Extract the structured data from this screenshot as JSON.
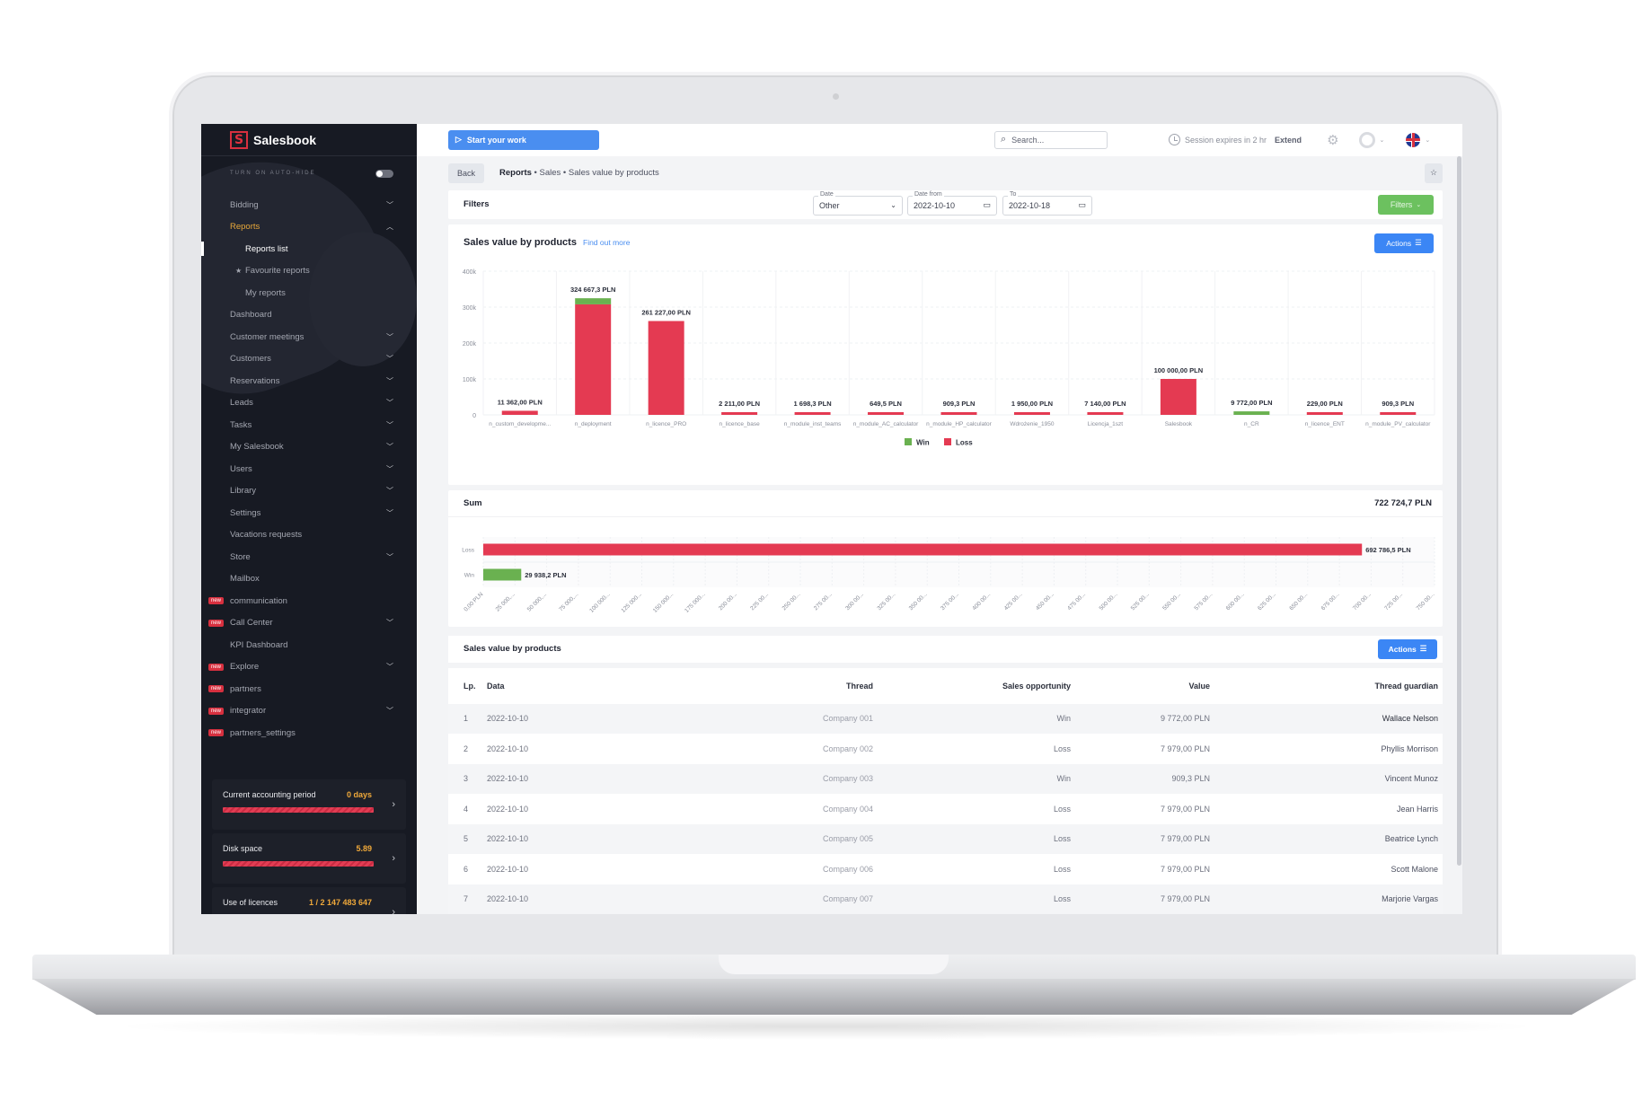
{
  "app": {
    "brand": "Salesbook",
    "logo_letter": "S"
  },
  "sidebar": {
    "autohide_label": "TURN ON AUTO-HIDE",
    "items": [
      {
        "label": "Bidding",
        "chevron": "down",
        "state": "",
        "badge": ""
      },
      {
        "label": "Reports",
        "chevron": "up",
        "state": "active",
        "badge": ""
      },
      {
        "label": "Reports list",
        "chevron": "",
        "state": "sub current",
        "badge": ""
      },
      {
        "label": "Favourite reports",
        "chevron": "",
        "state": "sub star",
        "badge": ""
      },
      {
        "label": "My reports",
        "chevron": "",
        "state": "sub",
        "badge": ""
      },
      {
        "label": "Dashboard",
        "chevron": "",
        "state": "",
        "badge": ""
      },
      {
        "label": "Customer meetings",
        "chevron": "down",
        "state": "",
        "badge": ""
      },
      {
        "label": "Customers",
        "chevron": "down",
        "state": "",
        "badge": ""
      },
      {
        "label": "Reservations",
        "chevron": "down",
        "state": "",
        "badge": ""
      },
      {
        "label": "Leads",
        "chevron": "down",
        "state": "",
        "badge": ""
      },
      {
        "label": "Tasks",
        "chevron": "down",
        "state": "",
        "badge": ""
      },
      {
        "label": "My Salesbook",
        "chevron": "down",
        "state": "",
        "badge": ""
      },
      {
        "label": "Users",
        "chevron": "down",
        "state": "",
        "badge": ""
      },
      {
        "label": "Library",
        "chevron": "down",
        "state": "",
        "badge": ""
      },
      {
        "label": "Settings",
        "chevron": "down",
        "state": "",
        "badge": ""
      },
      {
        "label": "Vacations requests",
        "chevron": "",
        "state": "",
        "badge": ""
      },
      {
        "label": "Store",
        "chevron": "down",
        "state": "",
        "badge": ""
      },
      {
        "label": "Mailbox",
        "chevron": "",
        "state": "",
        "badge": ""
      },
      {
        "label": "communication",
        "chevron": "",
        "state": "",
        "badge": "new"
      },
      {
        "label": "Call Center",
        "chevron": "down",
        "state": "",
        "badge": "new"
      },
      {
        "label": "KPI Dashboard",
        "chevron": "",
        "state": "",
        "badge": ""
      },
      {
        "label": "Explore",
        "chevron": "down",
        "state": "",
        "badge": "new"
      },
      {
        "label": "partners",
        "chevron": "",
        "state": "",
        "badge": "new"
      },
      {
        "label": "integrator",
        "chevron": "down",
        "state": "",
        "badge": "new"
      },
      {
        "label": "partners_settings",
        "chevron": "",
        "state": "",
        "badge": "new"
      }
    ],
    "stats": [
      {
        "label": "Current accounting period",
        "value": "0 days",
        "fill": 1.0
      },
      {
        "label": "Disk space",
        "value": "5.89",
        "fill": 1.0
      },
      {
        "label": "Use of licences",
        "value": "1 / 2 147 483 647",
        "fill": 0.0
      }
    ]
  },
  "topbar": {
    "start_label": "Start your work",
    "search_placeholder": "Search...",
    "session_text": "Session expires in 2 hr",
    "extend_label": "Extend"
  },
  "breadcrumb": {
    "back_label": "Back",
    "root": "Reports",
    "separator": "•",
    "level2": "Sales",
    "current": "Sales value by products"
  },
  "filters": {
    "title": "Filters",
    "date_label": "Date",
    "date_value": "Other",
    "from_label": "Date from",
    "from_value": "2022-10-10",
    "to_label": "To",
    "to_value": "2022-10-18",
    "button_label": "Filters"
  },
  "chart_section": {
    "title": "Sales value by products",
    "link": "Find out more",
    "actions_label": "Actions"
  },
  "sum_section": {
    "title": "Sum",
    "total": "722 724,7 PLN"
  },
  "colors": {
    "win": "#6ab150",
    "loss": "#e43a52",
    "accent": "#3b86f5",
    "active_nav": "#e8a83a"
  },
  "chart_data": [
    {
      "type": "bar",
      "stacked": true,
      "title": "Sales value by products",
      "xlabel": "",
      "ylabel": "",
      "ylim": [
        0,
        400000
      ],
      "yticks": [
        "0",
        "100k",
        "200k",
        "300k",
        "400k"
      ],
      "yticks_values": [
        0,
        100000,
        200000,
        300000,
        400000
      ],
      "grid": true,
      "legend": "bottom-center",
      "categories": [
        "n_custom_developme...",
        "n_deployment",
        "n_licence_PRO",
        "n_licence_base",
        "n_module_inst_teams",
        "n_module_AC_calculator",
        "n_module_HP_calculator",
        "Wdrożenie_1950",
        "Licencja_1szt",
        "Salesbook",
        "n_CR",
        "n_licence_ENT",
        "n_module_PV_calculator"
      ],
      "data_labels": [
        "11 362,00 PLN",
        "324 667,3 PLN",
        "261 227,00 PLN",
        "2 211,00 PLN",
        "1 698,3 PLN",
        "649,5 PLN",
        "909,3 PLN",
        "1 950,00 PLN",
        "7 140,00 PLN",
        "100 000,00 PLN",
        "9 772,00 PLN",
        "229,00 PLN",
        "909,3 PLN"
      ],
      "series": [
        {
          "name": "Win",
          "color": "#6ab150",
          "values": [
            0,
            17000,
            0,
            0,
            0,
            0,
            0,
            0,
            0,
            0,
            9772,
            0,
            0
          ]
        },
        {
          "name": "Loss",
          "color": "#e43a52",
          "values": [
            11362,
            307667.3,
            261227,
            2211,
            1698.3,
            649.5,
            909.3,
            1950,
            7140,
            100000,
            0,
            229,
            909.3
          ]
        }
      ]
    },
    {
      "type": "bar",
      "orientation": "horizontal",
      "title": "Sum",
      "categories": [
        "Loss",
        "Win"
      ],
      "values": [
        692786.5,
        29938.2
      ],
      "data_labels": [
        "692 786,5 PLN",
        "29 938,2 PLN"
      ],
      "colors": [
        "#e43a52",
        "#6ab150"
      ],
      "xlim": [
        0,
        750000
      ],
      "xticks": [
        "0,00 PLN",
        "25 000,...",
        "50 000,...",
        "75 000,...",
        "100 000...",
        "125 000...",
        "150 000...",
        "175 000...",
        "200 00...",
        "225 00...",
        "250 00...",
        "275 00...",
        "300 00...",
        "325 00...",
        "350 00...",
        "375 00...",
        "400 00...",
        "425 00...",
        "450 00...",
        "475 00...",
        "500 00...",
        "525 00...",
        "550 00...",
        "575 00...",
        "600 00...",
        "625 00...",
        "650 00...",
        "675 00...",
        "700 00...",
        "725 00...",
        "750 00..."
      ],
      "grid": true
    }
  ],
  "table": {
    "title": "Sales value by products",
    "actions_label": "Actions",
    "columns": [
      "Lp.",
      "Data",
      "Thread",
      "Sales opportunity",
      "Value",
      "Thread guardian"
    ],
    "rows": [
      [
        "1",
        "2022-10-10",
        "Company 001",
        "Win",
        "9 772,00 PLN",
        "Wallace Nelson"
      ],
      [
        "2",
        "2022-10-10",
        "Company 002",
        "Loss",
        "7 979,00 PLN",
        "Phyllis Morrison"
      ],
      [
        "3",
        "2022-10-10",
        "Company 003",
        "Win",
        "909,3 PLN",
        "Vincent Munoz"
      ],
      [
        "4",
        "2022-10-10",
        "Company 004",
        "Loss",
        "7 979,00 PLN",
        "Jean Harris"
      ],
      [
        "5",
        "2022-10-10",
        "Company 005",
        "Loss",
        "7 979,00 PLN",
        "Beatrice Lynch"
      ],
      [
        "6",
        "2022-10-10",
        "Company 006",
        "Loss",
        "7 979,00 PLN",
        "Scott Malone"
      ],
      [
        "7",
        "2022-10-10",
        "Company 007",
        "Loss",
        "7 979,00 PLN",
        "Marjorie Vargas"
      ]
    ]
  }
}
